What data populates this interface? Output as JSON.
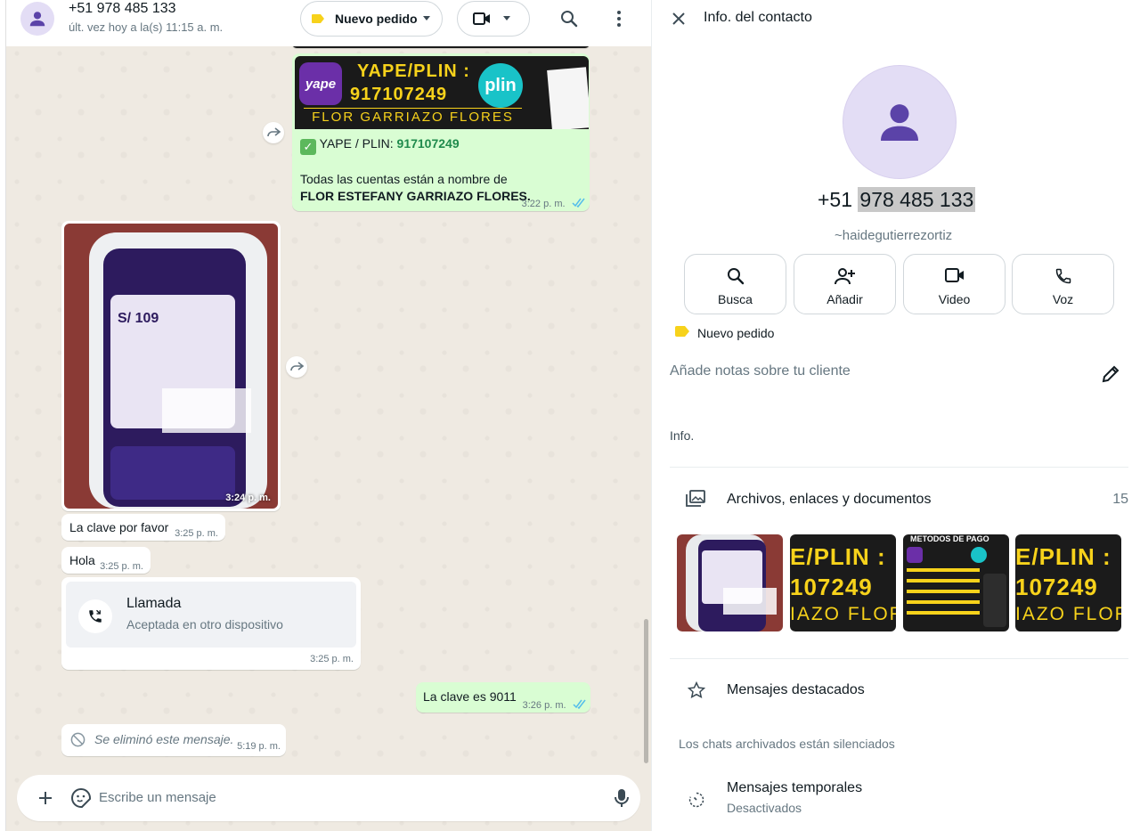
{
  "chat": {
    "contact_name": "+51 978 485 133",
    "last_seen": "últ. vez hoy a la(s) 11:15 a. m.",
    "label_button": "Nuevo pedido",
    "messages": {
      "yape": {
        "banner_title": "YAPE/PLIN :",
        "banner_number": "917107249",
        "banner_owner": "FLOR GARRIAZO FLORES",
        "yape_logo": "yape",
        "plin_logo": "plin",
        "line1_prefix": "YAPE / PLIN: ",
        "line1_number": "917107249",
        "line2": "Todas las cuentas están a nombre de",
        "line3": "FLOR ESTEFANY GARRIAZO FLORES.",
        "time": "3:22 p. m."
      },
      "image": {
        "time": "3:24 p. m.",
        "amount": "S/ 109"
      },
      "text1": {
        "text": "La clave por favor",
        "time": "3:25 p. m."
      },
      "text2": {
        "text": "Hola",
        "time": "3:25 p. m."
      },
      "call": {
        "title": "Llamada",
        "subtitle": "Aceptada en otro dispositivo",
        "time": "3:25 p. m."
      },
      "out1": {
        "text": "La clave es 9011",
        "time": "3:26 p. m."
      },
      "deleted": {
        "text": "Se eliminó este mensaje.",
        "time": "5:19 p. m."
      }
    },
    "composer_placeholder": "Escribe un mensaje"
  },
  "info": {
    "title": "Info. del contacto",
    "phone_prefix": "+51 ",
    "phone_rest": "978 485 133",
    "username": "~haidegutierrezortiz",
    "actions": [
      {
        "label": "Busca",
        "icon": "search-icon"
      },
      {
        "label": "Añadir",
        "icon": "add-person-icon"
      },
      {
        "label": "Video",
        "icon": "video-icon"
      },
      {
        "label": "Voz",
        "icon": "phone-icon"
      }
    ],
    "label": "Nuevo pedido",
    "notes_placeholder": "Añade notas sobre tu cliente",
    "section_info": "Info.",
    "media_label": "Archivos, enlaces y documentos",
    "media_count": "15",
    "thumb_texts": [
      "E/PLIN :",
      "107249",
      "IAZO FLOR"
    ],
    "thumb3_title": "METODOS DE PAGO",
    "starred": "Mensajes destacados",
    "archived_note": "Los chats archivados están silenciados",
    "temp_title": "Mensajes temporales",
    "temp_status": "Desactivados"
  },
  "colors": {
    "outgoing_bubble": "#d9fdd3",
    "chat_background": "#efeae2",
    "label_yellow": "#f7d21b",
    "read_ticks": "#53bdeb",
    "phone_green": "#1f8a4c"
  }
}
